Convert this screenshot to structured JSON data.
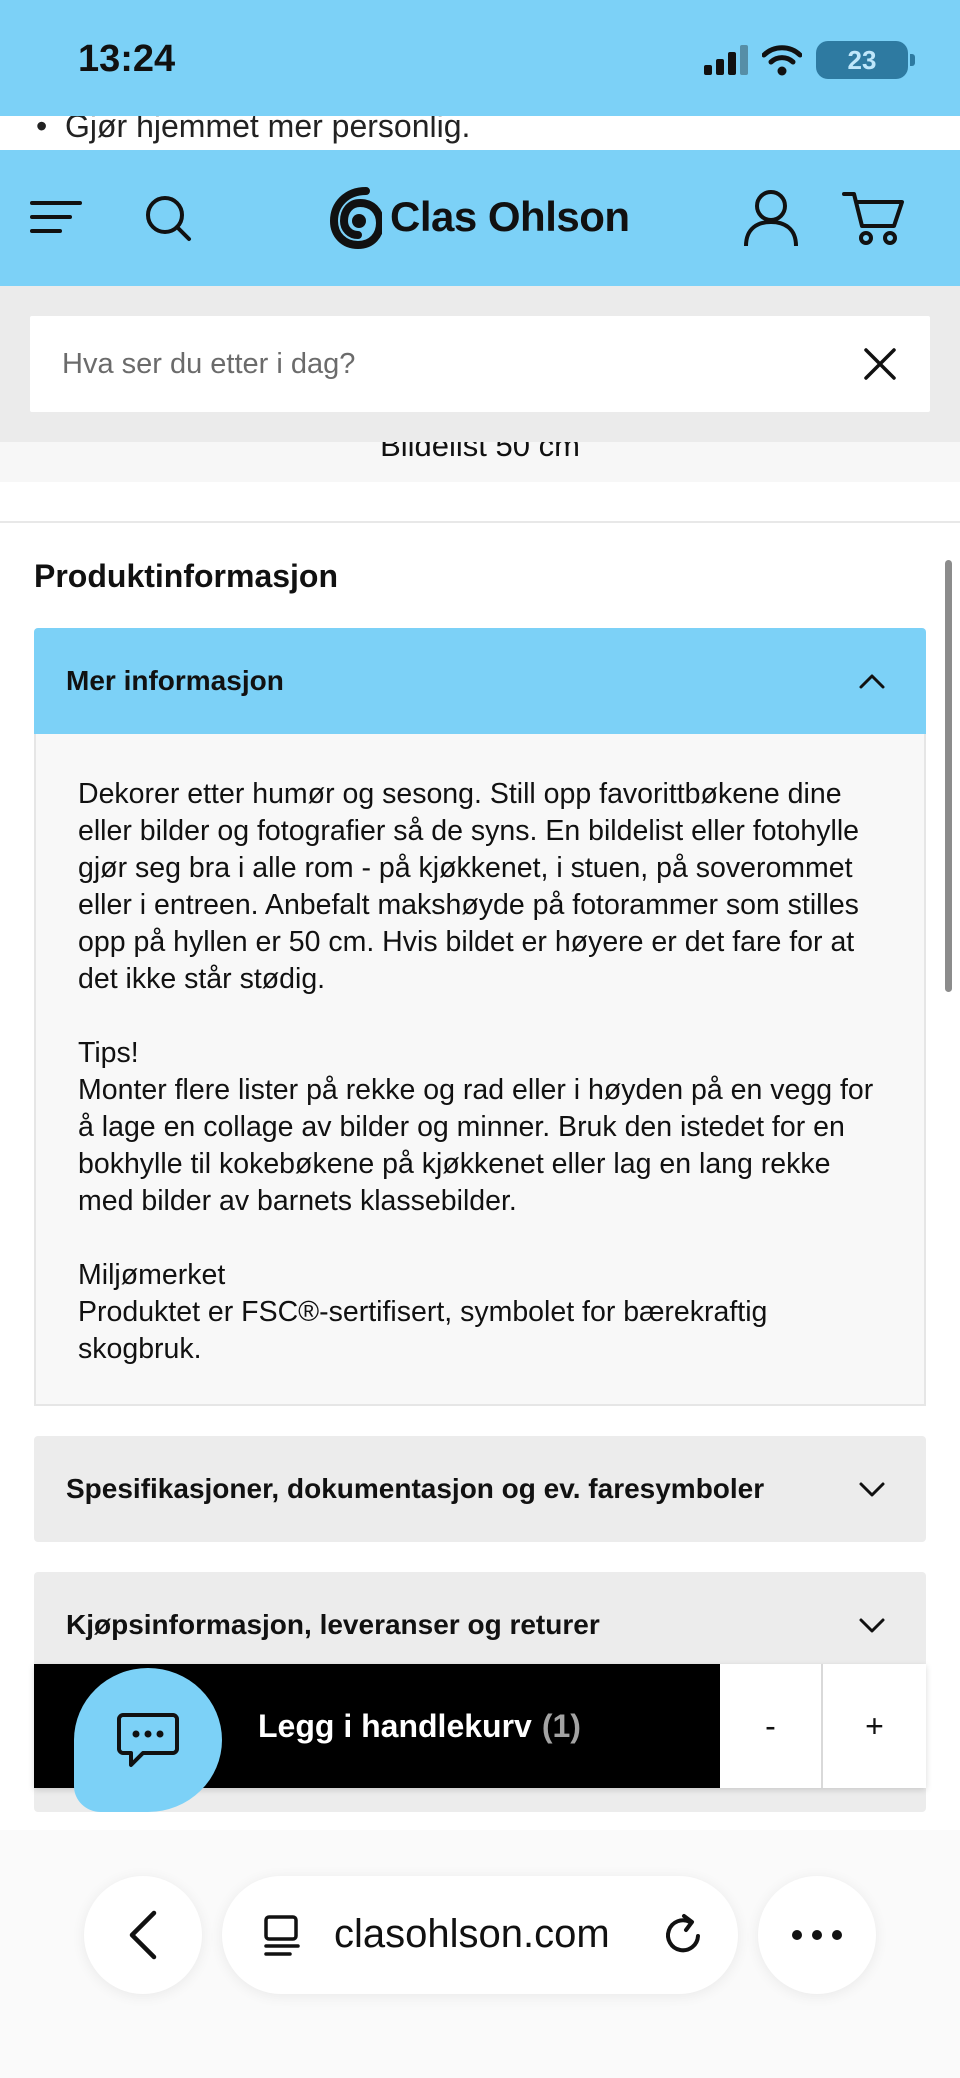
{
  "status_bar": {
    "time": "13:24",
    "battery": "23",
    "icons": [
      "signal-icon",
      "wifi-icon",
      "battery-icon"
    ]
  },
  "scrolled_text_top": "Gjør hjemmet mer personlig.",
  "header": {
    "brand": "Clas Ohlson",
    "icons": [
      "menu-icon",
      "search-icon",
      "account-icon",
      "cart-icon"
    ]
  },
  "search": {
    "placeholder": "Hva ser du etter i dag?"
  },
  "scrolled_product_title": "Bildelist 50 cm",
  "product_info": {
    "title": "Produktinformasjon",
    "open_section": {
      "title": "Mer informasjon",
      "paragraphs": [
        "Dekorer etter humør og sesong. Still opp favorittbøkene dine eller bilder og fotografier så de syns. En bildelist eller fotohylle gjør seg bra i alle rom - på kjøkkenet, i stuen, på soverommet eller i entreen. Anbefalt makshøyde på fotorammer som stilles opp på hyllen er 50 cm. Hvis bildet er høyere er det fare for at det ikke står stødig.",
        "Tips!\nMonter flere lister på rekke og rad eller i høyden på en vegg for å lage en collage av bilder og minner. Bruk den istedet for en bokhylle til kokebøkene på kjøkkenet eller lag en lang rekke med bilder av barnets klassebilder.",
        "Miljømerket\nProduktet er FSC®-sertifisert, symbolet for bærekraftig skogbruk."
      ]
    },
    "collapsed_sections": [
      "Spesifikasjoner, dokumentasjon og ev. faresymboler",
      "Kjøpsinformasjon, leveranser og returer"
    ]
  },
  "cart_bar": {
    "add_label": "Legg i handlekurv",
    "count": "(1)",
    "minus": "-",
    "plus": "+"
  },
  "browser": {
    "url": "clasohlson.com"
  },
  "colors": {
    "brand_blue": "#7cd1f7",
    "cart_button": "#000000",
    "collapsed_bg": "#ececec"
  }
}
